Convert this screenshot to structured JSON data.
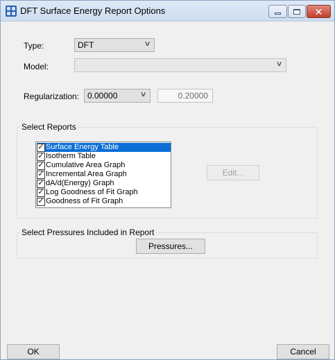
{
  "window": {
    "title": "DFT Surface Energy Report Options",
    "controls": {
      "minimize": "–",
      "maximize": "□",
      "close": "✕"
    }
  },
  "type": {
    "label": "Type:",
    "value": "DFT"
  },
  "model": {
    "label": "Model:",
    "value": ""
  },
  "regularization": {
    "label": "Regularization:",
    "value": "0.00000",
    "secondary_value": "0.20000"
  },
  "select_reports": {
    "title": "Select Reports",
    "items": [
      {
        "label": "Surface Energy Table",
        "checked": true,
        "selected": true
      },
      {
        "label": "Isotherm Table",
        "checked": true,
        "selected": false
      },
      {
        "label": "Cumulative Area Graph",
        "checked": true,
        "selected": false
      },
      {
        "label": "Incremental Area Graph",
        "checked": true,
        "selected": false
      },
      {
        "label": "dA/d(Energy) Graph",
        "checked": true,
        "selected": false
      },
      {
        "label": "Log Goodness of Fit Graph",
        "checked": true,
        "selected": false
      },
      {
        "label": "Goodness of Fit Graph",
        "checked": true,
        "selected": false
      }
    ],
    "edit_label": "Edit..."
  },
  "select_pressures": {
    "title": "Select Pressures Included in Report",
    "button_label": "Pressures..."
  },
  "footer": {
    "ok_label": "OK",
    "cancel_label": "Cancel"
  },
  "icons": {
    "check": "✓",
    "chevron": "∨"
  }
}
